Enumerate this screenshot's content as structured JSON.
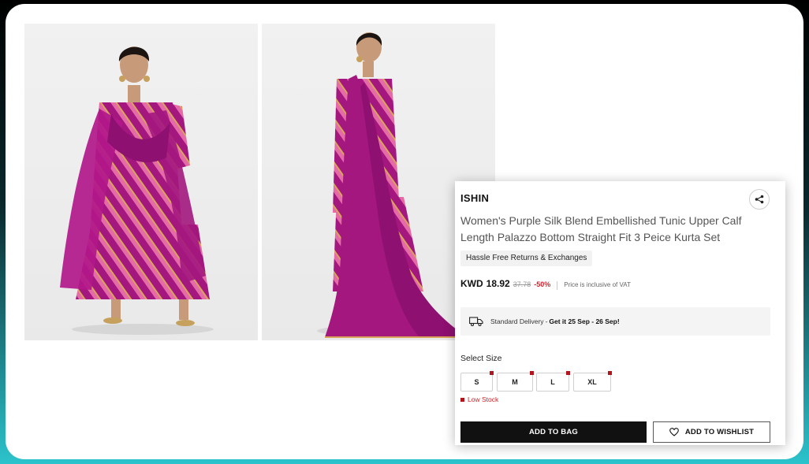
{
  "product": {
    "brand": "ISHIN",
    "title": "Women's Purple Silk Blend Embellished Tunic Upper Calf Length Palazzo Bottom Straight Fit 3 Peice Kurta Set",
    "returns_tag": "Hassle Free Returns & Exchanges",
    "price": {
      "currency": "KWD",
      "current": "18.92",
      "original": "37.78",
      "discount": "-50%",
      "vat_note": "Price is inclusive of VAT"
    },
    "delivery": {
      "label": "Standard Delivery",
      "separator": "-",
      "dates": "Get it 25 Sep - 26 Sep!"
    },
    "size_label": "Select Size",
    "sizes": [
      "S",
      "M",
      "L",
      "XL"
    ],
    "stock_note": "Low Stock",
    "add_to_bag": "ADD TO BAG",
    "add_to_wishlist": "ADD TO WISHLIST"
  },
  "icons": {
    "share": "share-icon",
    "truck": "delivery-truck-icon",
    "heart": "heart-icon"
  },
  "colors": {
    "accent_red": "#d0242b",
    "stock_marker": "#b4151c",
    "button_dark": "#111111",
    "garment_purple": "#a3177e",
    "frame_gradient_bottom": "#2cc3cc"
  }
}
